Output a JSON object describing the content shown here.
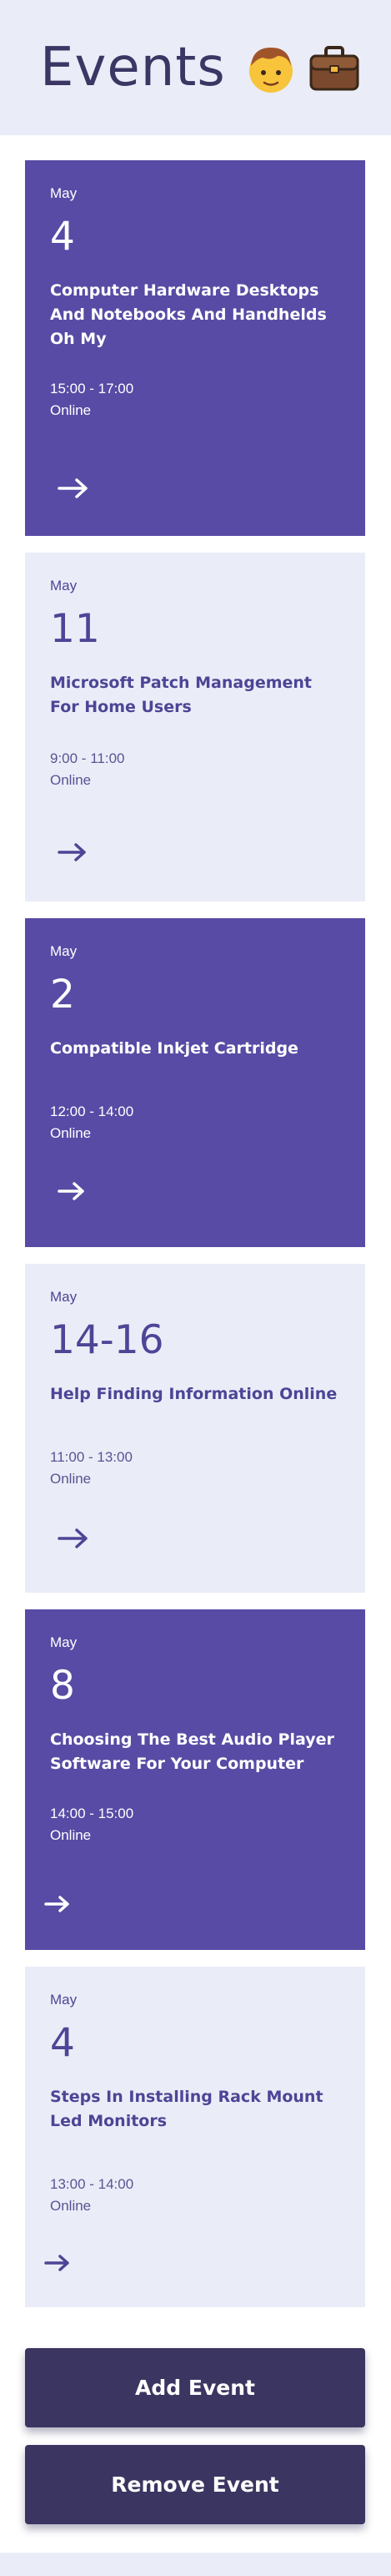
{
  "header": {
    "title": "Events",
    "icons": [
      "face-emoji-icon",
      "briefcase-emoji-icon"
    ]
  },
  "colors": {
    "dark_card": "#574ba5",
    "light_card": "#eaedf8",
    "button": "#3b3561",
    "title_text": "#3b3663"
  },
  "events": [
    {
      "month": "May",
      "day": "4",
      "title": "Computer Hardware Desktops And Notebooks And Handhelds Oh My",
      "time": "15:00 - 17:00",
      "location": "Online",
      "style": "dark"
    },
    {
      "month": "May",
      "day": "11",
      "title": "Microsoft Patch Management For Home Users",
      "time": "9:00 - 11:00",
      "location": "Online",
      "style": "light"
    },
    {
      "month": "May",
      "day": "2",
      "title": "Compatible Inkjet Cartridge",
      "time": "12:00 - 14:00",
      "location": "Online",
      "style": "dark"
    },
    {
      "month": "May",
      "day": "14-16",
      "title": "Help Finding Information Online",
      "time": "11:00 - 13:00",
      "location": "Online",
      "style": "light"
    },
    {
      "month": "May",
      "day": "8",
      "title": "Choosing The Best Audio Player Software For Your Computer",
      "time": "14:00 - 15:00",
      "location": "Online",
      "style": "dark"
    },
    {
      "month": "May",
      "day": "4",
      "title": "Steps In Installing Rack Mount Led Monitors",
      "time": "13:00 - 14:00",
      "location": "Online",
      "style": "light"
    }
  ],
  "actions": {
    "add_label": "Add Event",
    "remove_label": "Remove Event"
  }
}
